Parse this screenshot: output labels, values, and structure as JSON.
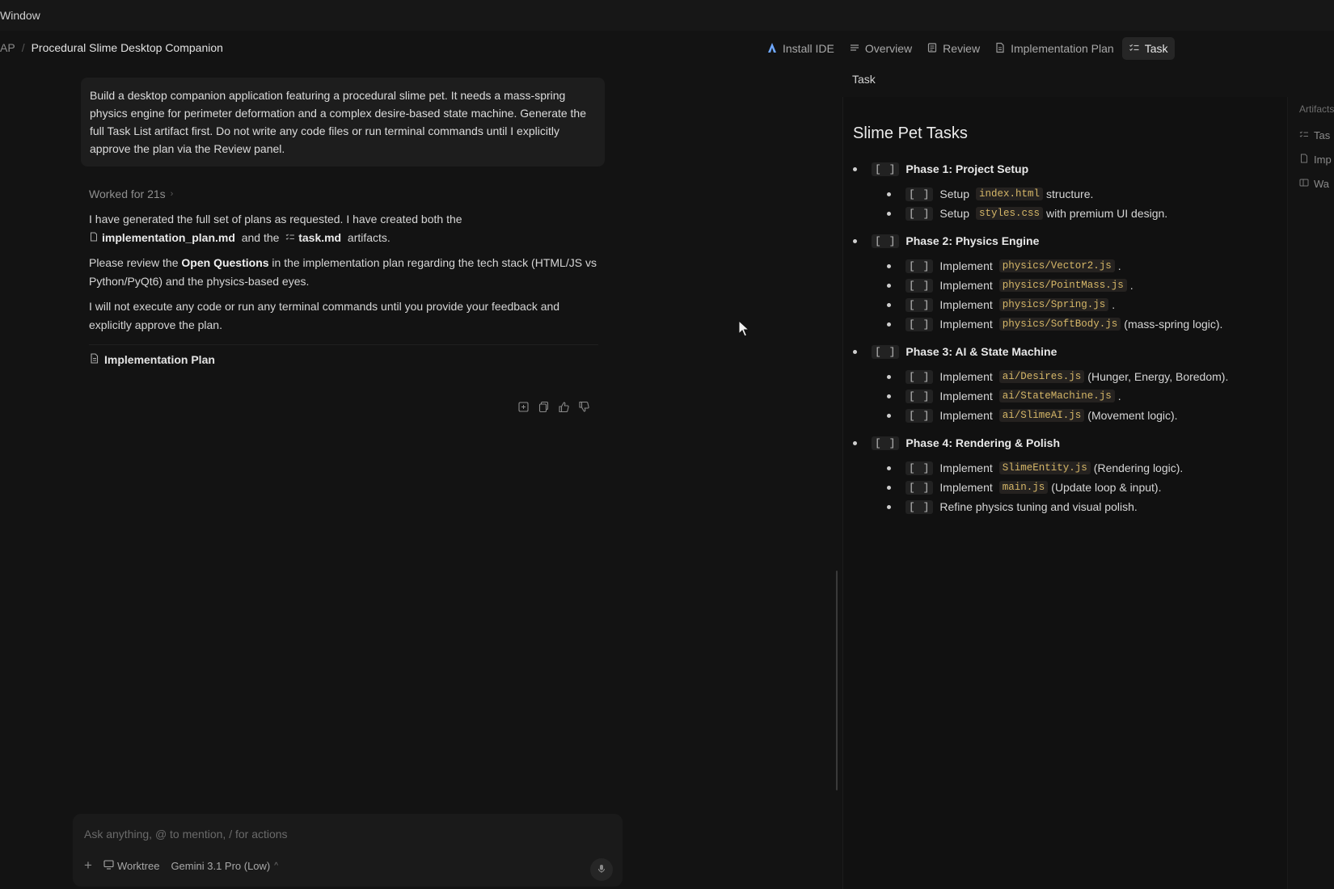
{
  "menubar": {
    "window_menu": "Window"
  },
  "breadcrumb": {
    "root": "AP",
    "separator": "/",
    "title": "Procedural Slime Desktop Companion"
  },
  "tabs": {
    "install_ide": "Install IDE",
    "overview": "Overview",
    "review": "Review",
    "implementation_plan": "Implementation Plan",
    "task": "Task"
  },
  "chat": {
    "prompt": "Build a desktop companion application featuring a procedural slime pet. It needs a mass-spring physics engine for perimeter deformation and a complex desire-based state machine. Generate the full Task List artifact first. Do not write any code files or run terminal commands until I explicitly approve the plan via the Review panel.",
    "worked_label": "Worked for 21s",
    "p1_a": "I have generated the full set of plans as requested. I have created both the",
    "p1_file1": "implementation_plan.md",
    "p1_b": "and the",
    "p1_file2": "task.md",
    "p1_c": "artifacts.",
    "p2_a": "Please review the",
    "p2_bold": "Open Questions",
    "p2_b": "in the implementation plan regarding the tech stack (HTML/JS vs Python/PyQt6) and the physics-based eyes.",
    "p3": "I will not execute any code or run any terminal commands until you provide your feedback and explicitly approve the plan.",
    "plan_link": "Implementation Plan"
  },
  "composer": {
    "placeholder": "Ask anything, @ to mention, / for actions",
    "plus": "+",
    "worktree": "Worktree",
    "model": "Gemini 3.1 Pro (Low)"
  },
  "doc": {
    "tab_title": "Task",
    "heading": "Slime Pet Tasks",
    "checkbox": "[ ]",
    "phases": [
      {
        "label": "Phase 1: Project Setup",
        "items": [
          {
            "pre": "Setup",
            "code": "index.html",
            "post": "structure."
          },
          {
            "pre": "Setup",
            "code": "styles.css",
            "post": "with premium UI design."
          }
        ]
      },
      {
        "label": "Phase 2: Physics Engine",
        "items": [
          {
            "pre": "Implement",
            "code": "physics/Vector2.js",
            "post": "."
          },
          {
            "pre": "Implement",
            "code": "physics/PointMass.js",
            "post": "."
          },
          {
            "pre": "Implement",
            "code": "physics/Spring.js",
            "post": "."
          },
          {
            "pre": "Implement",
            "code": "physics/SoftBody.js",
            "post": "(mass-spring logic)."
          }
        ]
      },
      {
        "label": "Phase 3: AI & State Machine",
        "items": [
          {
            "pre": "Implement",
            "code": "ai/Desires.js",
            "post": "(Hunger, Energy, Boredom)."
          },
          {
            "pre": "Implement",
            "code": "ai/StateMachine.js",
            "post": "."
          },
          {
            "pre": "Implement",
            "code": "ai/SlimeAI.js",
            "post": "(Movement logic)."
          }
        ]
      },
      {
        "label": "Phase 4: Rendering & Polish",
        "items": [
          {
            "pre": "Implement",
            "code": "SlimeEntity.js",
            "post": "(Rendering logic)."
          },
          {
            "pre": "Implement",
            "code": "main.js",
            "post": "(Update loop & input)."
          },
          {
            "pre": "Refine physics tuning and visual polish.",
            "code": "",
            "post": ""
          }
        ]
      }
    ]
  },
  "artifacts": {
    "header": "Artifacts",
    "items": [
      "Tas",
      "Imp",
      "Wa"
    ]
  }
}
